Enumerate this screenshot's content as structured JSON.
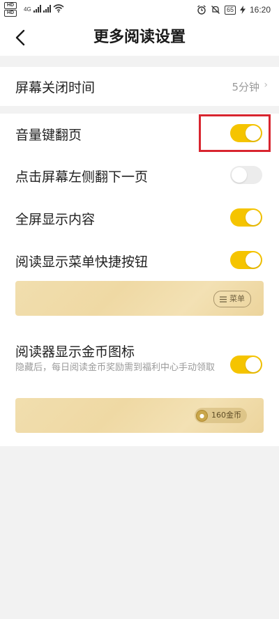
{
  "status_bar": {
    "sim1": "HD",
    "sim2": "HD",
    "network": "4G",
    "battery": "65",
    "time": "16:20"
  },
  "header": {
    "title": "更多阅读设置"
  },
  "settings": {
    "screen_off": {
      "label": "屏幕关闭时间",
      "value": "5分钟"
    },
    "volume_page_turn": {
      "label": "音量键翻页",
      "enabled": true
    },
    "tap_left_next": {
      "label": "点击屏幕左侧翻下一页",
      "enabled": false
    },
    "fullscreen": {
      "label": "全屏显示内容",
      "enabled": true
    },
    "menu_shortcut": {
      "label": "阅读显示菜单快捷按钮",
      "enabled": true,
      "preview_chip": "菜单"
    },
    "coin_icon": {
      "label": "阅读器显示金币图标",
      "description": "隐藏后，每日阅读金币奖励需到福利中心手动领取",
      "enabled": true,
      "preview_chip": "160金币"
    }
  },
  "colors": {
    "accent": "#f5c400",
    "highlight": "#d8252f",
    "toggle_off": "#ececec"
  }
}
